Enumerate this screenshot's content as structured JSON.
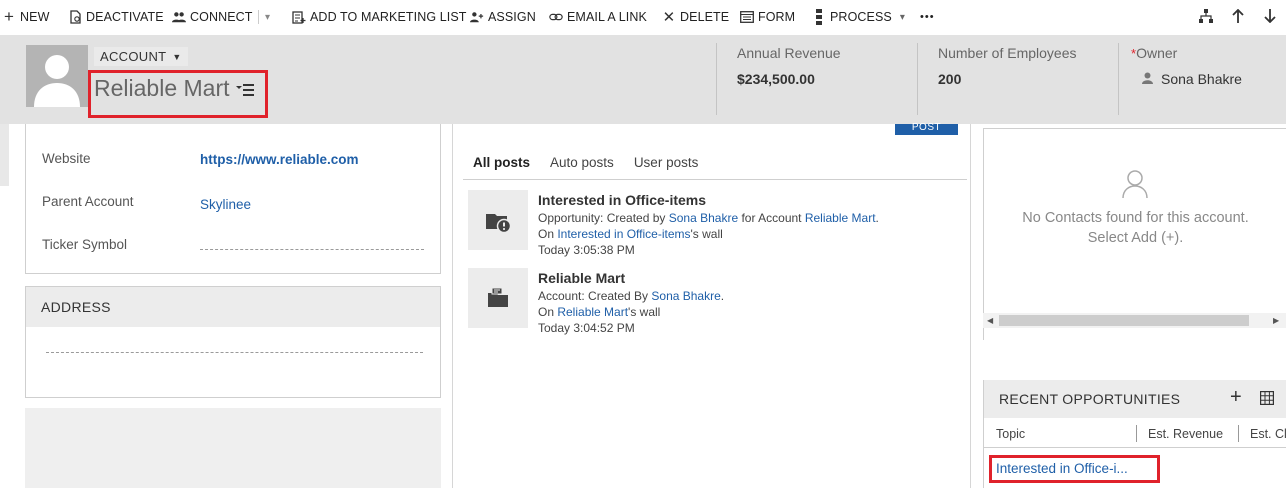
{
  "toolbar": {
    "items": [
      {
        "label": "NEW",
        "icon": "plus-icon"
      },
      {
        "label": "DEACTIVATE",
        "icon": "document-deactivate-icon"
      },
      {
        "label": "CONNECT",
        "icon": "people-icon"
      },
      {
        "label": "ADD TO MARKETING LIST",
        "icon": "list-add-icon"
      },
      {
        "label": "ASSIGN",
        "icon": "assign-icon"
      },
      {
        "label": "EMAIL A LINK",
        "icon": "link-icon"
      },
      {
        "label": "DELETE",
        "icon": "close-icon"
      },
      {
        "label": "FORM",
        "icon": "form-icon"
      },
      {
        "label": "PROCESS",
        "icon": "process-icon"
      }
    ],
    "more_glyph": "•••",
    "dropdown_glyph": "▾"
  },
  "header": {
    "entity_type": "ACCOUNT",
    "record_name": "Reliable Mart",
    "annual_revenue_label": "Annual Revenue",
    "annual_revenue_value": "$234,500.00",
    "employees_label": "Number of Employees",
    "employees_value": "200",
    "owner_required": "*",
    "owner_label": "Owner",
    "owner_value": "Sona Bhakre"
  },
  "summary": {
    "website_label": "Website",
    "website_value": "https://www.reliable.com",
    "parent_label": "Parent Account",
    "parent_value": "Skylinee",
    "ticker_label": "Ticker Symbol"
  },
  "address": {
    "title": "ADDRESS"
  },
  "posts": {
    "post_button": "POST",
    "tabs": [
      "All posts",
      "Auto posts",
      "User posts"
    ],
    "items": [
      {
        "title": "Interested in Office-items",
        "line1_prefix": "Opportunity: Created by ",
        "line1_user": "Sona Bhakre",
        "line1_mid": " for Account ",
        "line1_account": "Reliable Mart",
        "line1_suffix": ".",
        "line2_prefix": "On ",
        "line2_link": "Interested in Office-items",
        "line2_suffix": "'s wall",
        "time": "Today 3:05:38 PM"
      },
      {
        "title": "Reliable Mart",
        "line1_prefix": "Account: Created By ",
        "line1_user": "Sona Bhakre",
        "line1_suffix": ".",
        "line2_prefix": "On ",
        "line2_link": "Reliable Mart",
        "line2_suffix": "'s wall",
        "time": "Today 3:04:52 PM"
      }
    ]
  },
  "contacts": {
    "empty_line1": "No Contacts found for this account.",
    "empty_line2": "Select Add (+)."
  },
  "recent": {
    "title": "RECENT OPPORTUNITIES",
    "plus": "+",
    "columns": [
      "Topic",
      "Est. Revenue",
      "Est. Clo"
    ],
    "rows": [
      {
        "topic": "Interested in Office-i..."
      }
    ]
  },
  "colors": {
    "link": "#1f5fa8",
    "highlight": "#e0222b",
    "header_bg": "#e2e2e2"
  }
}
